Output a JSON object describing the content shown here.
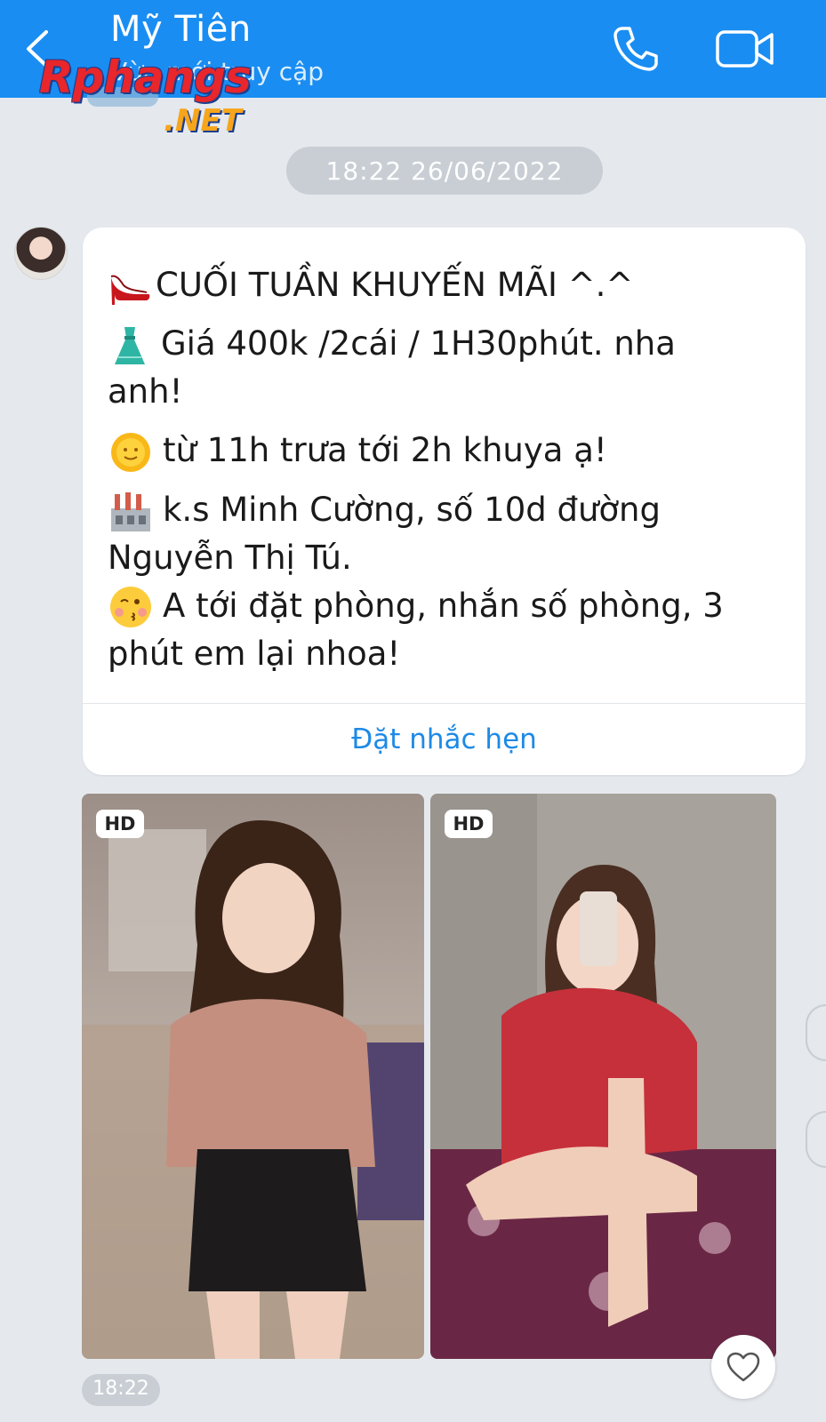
{
  "header": {
    "contact_name": "Mỹ Tiên",
    "status_text": "Vừa mới truy cập",
    "back_icon": "chevron-left-icon",
    "call_icon": "phone-icon",
    "video_icon": "video-camera-icon",
    "background_color": "#1a8df2"
  },
  "watermark": {
    "brand": "Rphangs",
    "suffix": ".NET"
  },
  "conversation": {
    "timestamp": "18:22 26/06/2022",
    "message": {
      "lines": [
        {
          "emoji": "high-heel-icon",
          "text": "CUỐI TUẦN KHUYẾN MÃI ^.^"
        },
        {
          "emoji": "dress-icon",
          "text": "Giá 400k /2cái / 1H30phút. nha"
        },
        {
          "emoji": "",
          "text": "anh!"
        },
        {
          "emoji": "sun-icon",
          "text": "từ 11h trưa tới 2h khuya ạ!"
        },
        {
          "emoji": "factory-icon",
          "text": "k.s Minh Cường, số 10d đường"
        },
        {
          "emoji": "",
          "text": "Nguyễn Thị Tú."
        },
        {
          "emoji": "kiss-face-icon",
          "text": "A tới đặt phòng, nhắn số phòng, 3"
        },
        {
          "emoji": "",
          "text": "phút em lại nhoa!"
        }
      ],
      "action_label": "Đặt nhắc hẹn"
    },
    "photos": [
      {
        "badge": "HD",
        "name": "photo-pink-shirt"
      },
      {
        "badge": "HD",
        "name": "photo-red-shirt"
      }
    ],
    "bottom_time": "18:22",
    "accent_color": "#1d8ae6"
  }
}
